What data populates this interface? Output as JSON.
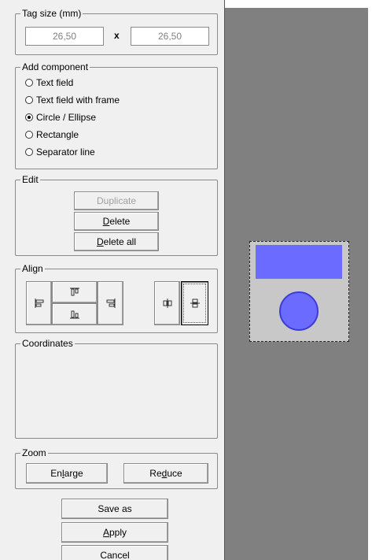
{
  "tag_size": {
    "title": "Tag size (mm)",
    "width_value": "26,50",
    "separator": "x",
    "height_value": "26,50"
  },
  "add_component": {
    "title": "Add component",
    "options": [
      {
        "label": "Text field",
        "checked": false
      },
      {
        "label": "Text field with frame",
        "checked": false
      },
      {
        "label": "Circle  / Ellipse",
        "checked": true
      },
      {
        "label": "Rectangle",
        "checked": false
      },
      {
        "label": "Separator line",
        "checked": false
      }
    ]
  },
  "edit": {
    "title": "Edit",
    "duplicate_label": "Duplicate",
    "delete_label_mnemonic": "D",
    "delete_label_rest": "elete",
    "delete_all_label_mnemonic": "D",
    "delete_all_label_rest": "elete all"
  },
  "align": {
    "title": "Align",
    "buttons": [
      "align-left-icon",
      "align-top-icon",
      "align-bottom-icon",
      "align-right-icon",
      "center-horizontal-icon",
      "center-vertical-icon"
    ]
  },
  "coordinates": {
    "title": "Coordinates"
  },
  "zoom": {
    "title": "Zoom",
    "enlarge_before": "En",
    "enlarge_mnemonic": "l",
    "enlarge_after": "arge",
    "reduce_before": "Re",
    "reduce_mnemonic": "d",
    "reduce_after": "uce"
  },
  "footer": {
    "save_as_label": "Save as",
    "apply_mnemonic": "A",
    "apply_rest": "pply",
    "cancel_label": "Cancel"
  },
  "colors": {
    "panel_bg": "#f0f0f0",
    "canvas_bg": "#808080",
    "tag_bg": "#c8c8c8",
    "shape_fill": "#6b6bff"
  }
}
